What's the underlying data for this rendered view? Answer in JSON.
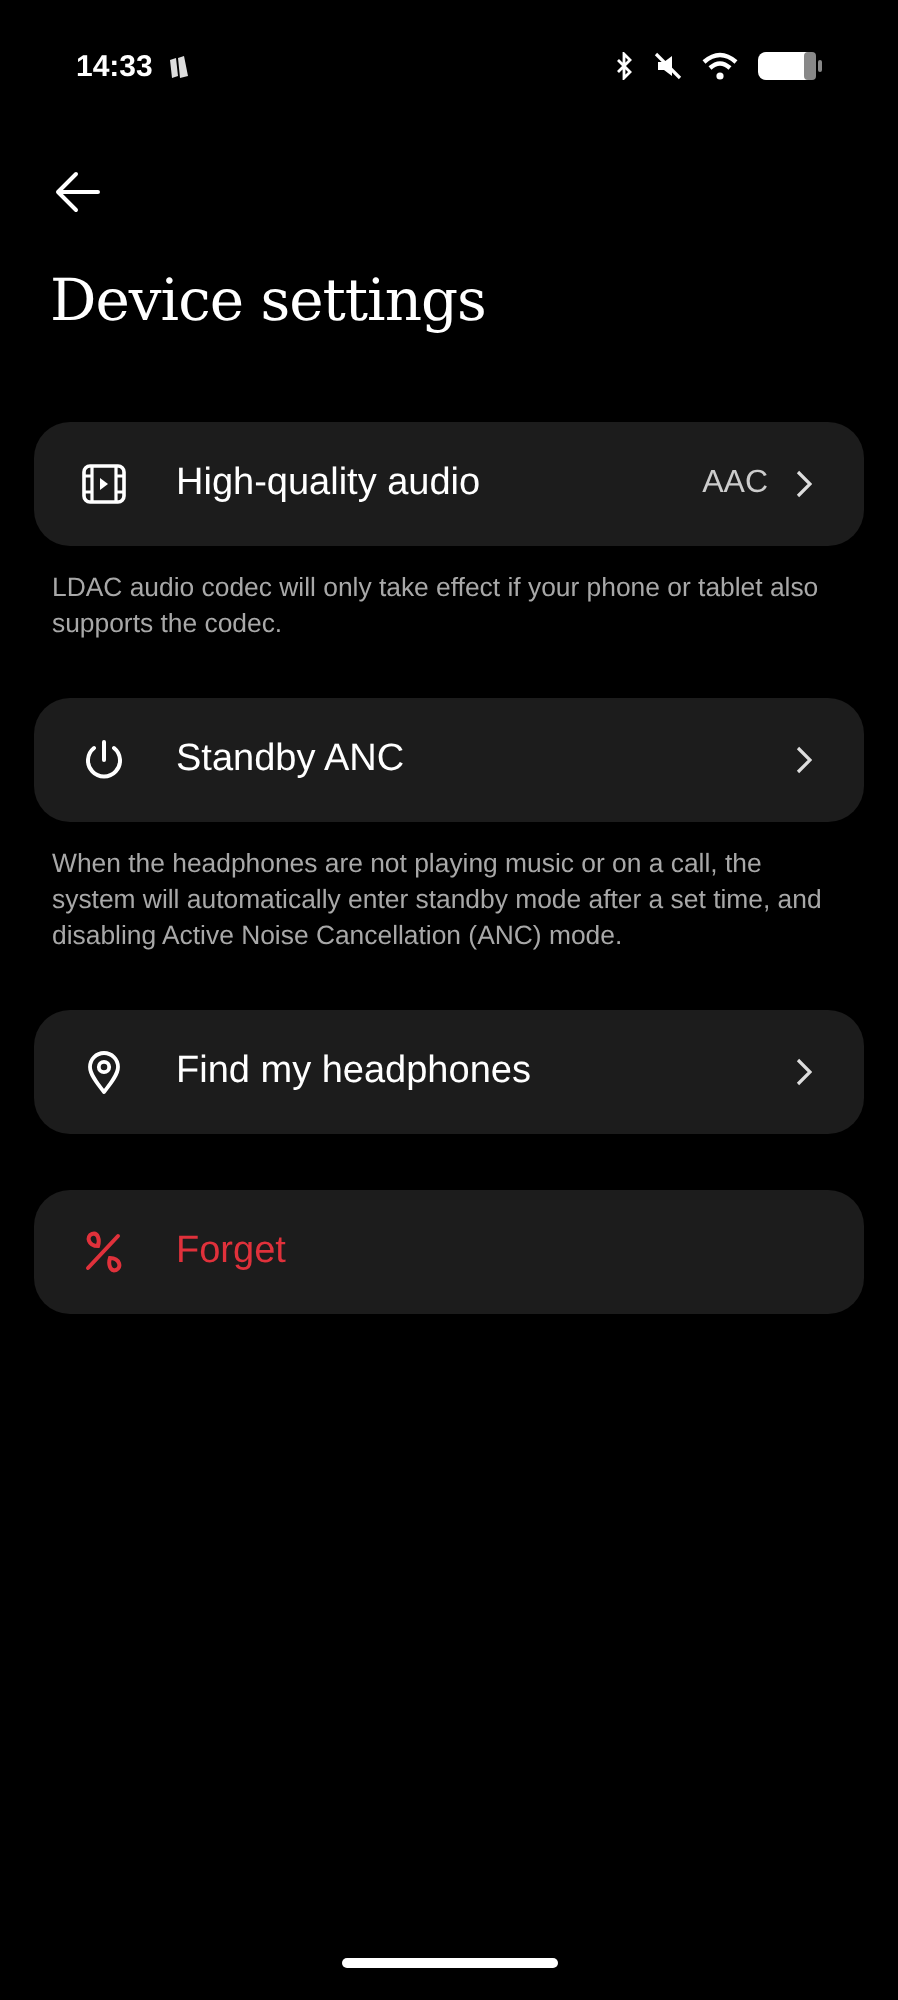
{
  "status_bar": {
    "time": "14:33"
  },
  "title": "Device settings",
  "items": [
    {
      "kind": "link",
      "label": "High-quality audio",
      "value": "AAC",
      "description": "LDAC audio codec will only take effect if your phone or tablet also supports the codec."
    },
    {
      "kind": "link",
      "label": "Standby ANC",
      "description": "When the headphones are not playing music or on a call, the system will automatically enter standby mode after a set time, and disabling Active Noise Cancellation (ANC) mode."
    },
    {
      "kind": "link",
      "label": "Find my headphones"
    },
    {
      "kind": "destructive",
      "label": "Forget"
    }
  ]
}
